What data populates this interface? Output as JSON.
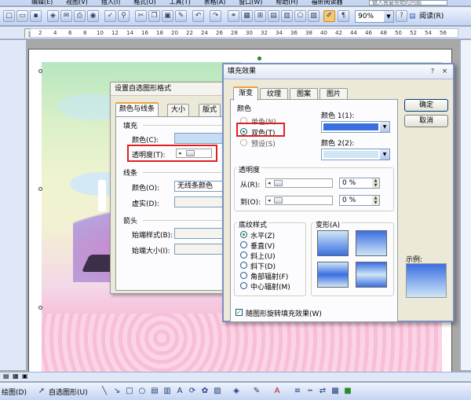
{
  "menubar": {
    "items": [
      "编辑(E)",
      "视图(V)",
      "插入(I)",
      "格式(O)",
      "工具(T)",
      "表格(A)",
      "窗口(W)",
      "帮助(H)",
      "福昕阅读器"
    ],
    "help_placeholder": "键入需要帮助的问题"
  },
  "toolbar": {
    "zoom": "90%",
    "read_label": "阅读(R)"
  },
  "ruler": {
    "numbers": [
      "2",
      "4",
      "6",
      "8",
      "10",
      "12",
      "14",
      "16",
      "18",
      "20",
      "22",
      "24",
      "26",
      "28",
      "30",
      "32",
      "34",
      "36",
      "38",
      "40",
      "42",
      "44",
      "46",
      "48",
      "50",
      "52",
      "54",
      "56"
    ]
  },
  "dialog_format": {
    "title": "设置自选图形格式",
    "tabs": [
      "颜色与线条",
      "大小",
      "版式"
    ],
    "fill_heading": "填充",
    "color_label": "颜色(C):",
    "transparency_label": "透明度(T):",
    "line_heading": "线条",
    "line_color_label": "颜色(O):",
    "line_color_value": "无线条颜色",
    "dash_label": "虚实(D):",
    "arrow_heading": "箭头",
    "begin_style_label": "始端样式(B):",
    "begin_size_label": "始端大小(I):"
  },
  "dialog_fill": {
    "title": "填充效果",
    "help": "?",
    "close": "×",
    "tabs": [
      "渐变",
      "纹理",
      "图案",
      "图片"
    ],
    "ok": "确定",
    "cancel": "取消",
    "colors_heading": "颜色",
    "color_options": [
      "单色(N)",
      "双色(T)",
      "预设(S)"
    ],
    "selected_color_option": "双色(T)",
    "color1_label": "颜色 1(1):",
    "color2_label": "颜色 2(2):",
    "color1": "#3a6fe0",
    "color2": "#cfe6f7",
    "transparency_heading": "透明度",
    "from_label": "从(R):",
    "to_label": "到(O):",
    "from_value": "0 %",
    "to_value": "0 %",
    "shading_heading": "底纹样式",
    "shading_options": [
      "水平(Z)",
      "垂直(V)",
      "斜上(U)",
      "斜下(D)",
      "角部辐射(F)",
      "中心辐射(M)"
    ],
    "selected_shading": "水平(Z)",
    "variants_heading": "变形(A)",
    "sample_label": "示例:",
    "rotate_checkbox": "随图形旋转填充效果(W)",
    "rotate_checked": true
  },
  "drawbar": {
    "draw_label": "绘图(D)",
    "autoshape_label": "自选图形(U)"
  }
}
